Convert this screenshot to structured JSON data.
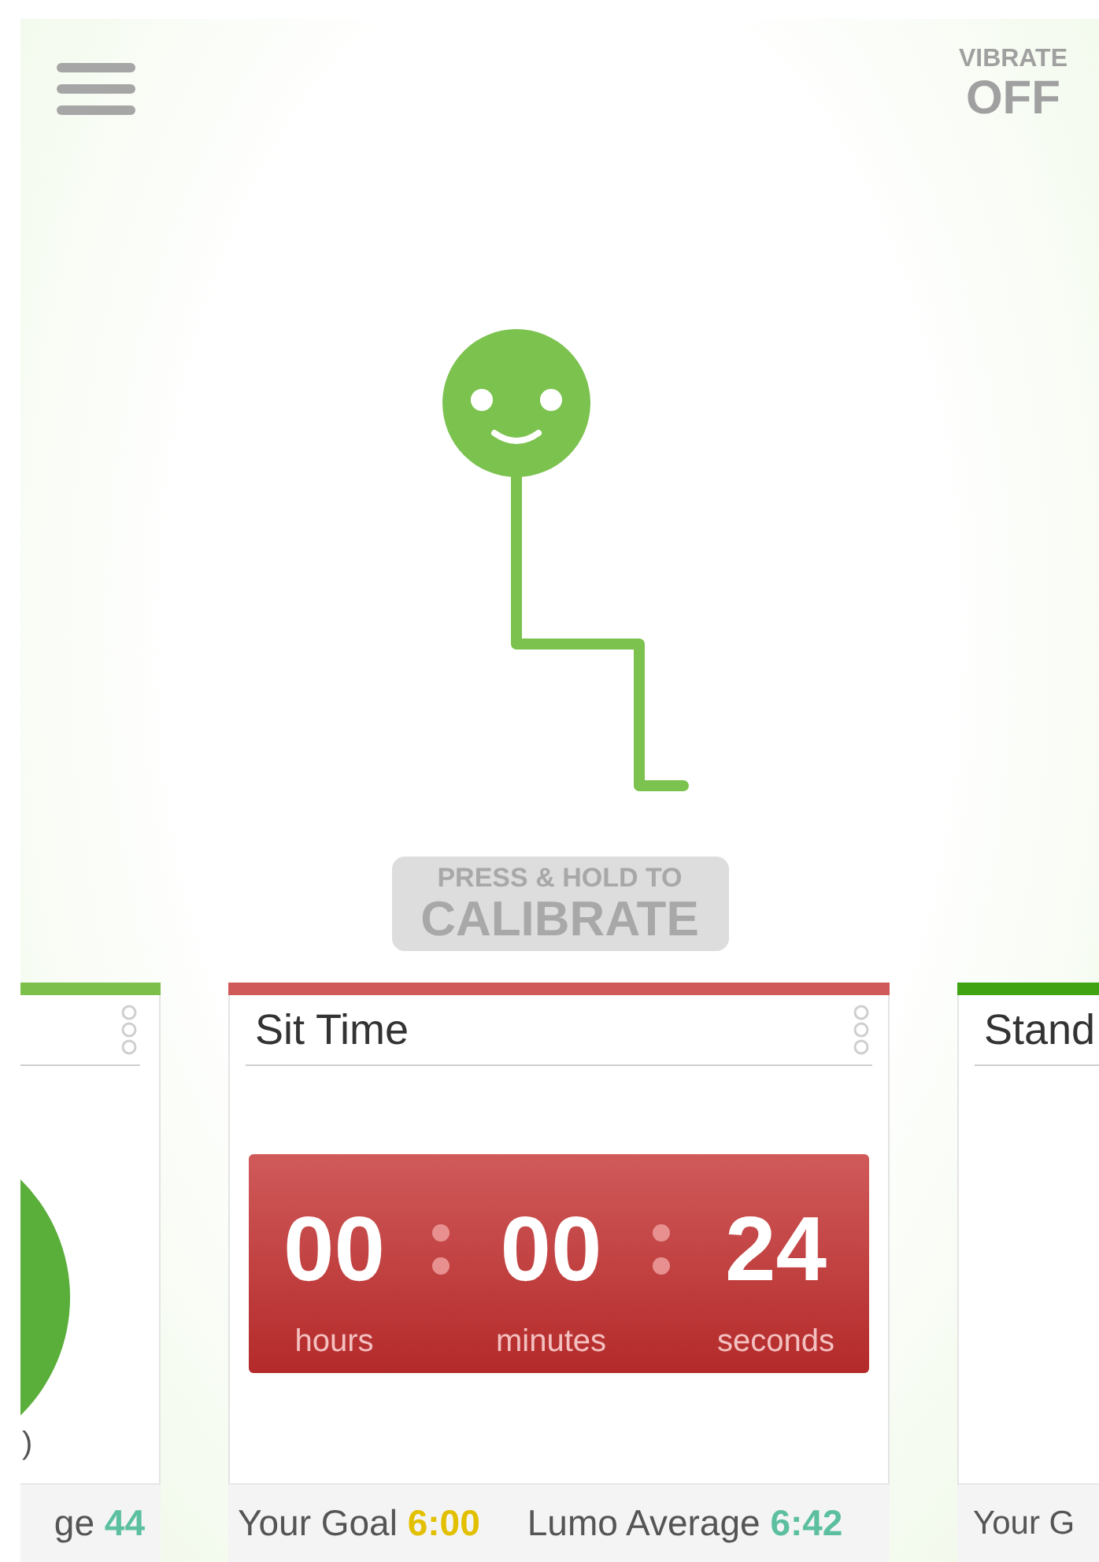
{
  "header": {
    "vibrate_label": "VIBRATE",
    "vibrate_value": "OFF"
  },
  "calibrate": {
    "line_1": "PRESS & HOLD TO",
    "line_2": "CALIBRATE"
  },
  "cards": [
    {
      "kind": "gauge",
      "color": "#7cc04b",
      "fragment": ")",
      "footer": [
        {
          "label": "ge",
          "value": "44",
          "color": "#5cbfa0"
        }
      ]
    },
    {
      "kind": "timer",
      "color": "#d05a5a",
      "title": "Sit Time",
      "timer": [
        {
          "value": "00",
          "unit": "hours"
        },
        {
          "value": "00",
          "unit": "minutes"
        },
        {
          "value": "24",
          "unit": "seconds"
        }
      ],
      "footer": [
        {
          "label": "Your Goal",
          "value": "6:00",
          "color": "#e2c000"
        },
        {
          "label": "Lumo Average",
          "value": "6:42",
          "color": "#5cbfa0"
        }
      ]
    },
    {
      "kind": "plain",
      "color": "#3fa312",
      "title": "Stand",
      "footer": [
        {
          "label": "Your G"
        }
      ]
    }
  ]
}
